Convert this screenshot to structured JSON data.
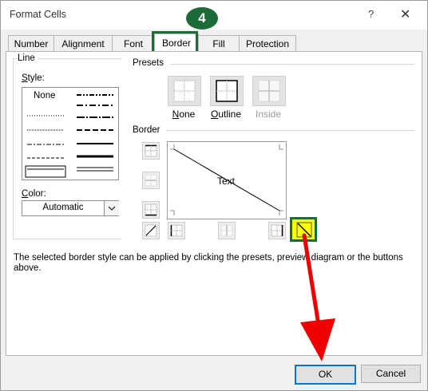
{
  "window": {
    "title": "Format Cells",
    "help_label": "?",
    "close_label": "✕"
  },
  "tabs": [
    {
      "label": "Number"
    },
    {
      "label": "Alignment"
    },
    {
      "label": "Font"
    },
    {
      "label": "Border",
      "active": true
    },
    {
      "label": "Fill"
    },
    {
      "label": "Protection"
    }
  ],
  "line_group": {
    "title": "Line",
    "style_label": "Style:",
    "none_label": "None",
    "color_label": "Color:",
    "color_value": "Automatic"
  },
  "presets_group": {
    "title": "Presets",
    "items": [
      {
        "label": "None"
      },
      {
        "label": "Outline"
      },
      {
        "label": "Inside",
        "disabled": true
      }
    ]
  },
  "border_group": {
    "title": "Border",
    "preview_text": "Text"
  },
  "hint_text": "The selected border style can be applied by clicking the presets, preview diagram or the buttons above.",
  "buttons": {
    "ok": "OK",
    "cancel": "Cancel"
  },
  "annotations": {
    "step_number": "4",
    "step_badge_color": "#1e6b3a",
    "highlight_color": "#ffff00",
    "arrow_color": "#ee0000"
  }
}
